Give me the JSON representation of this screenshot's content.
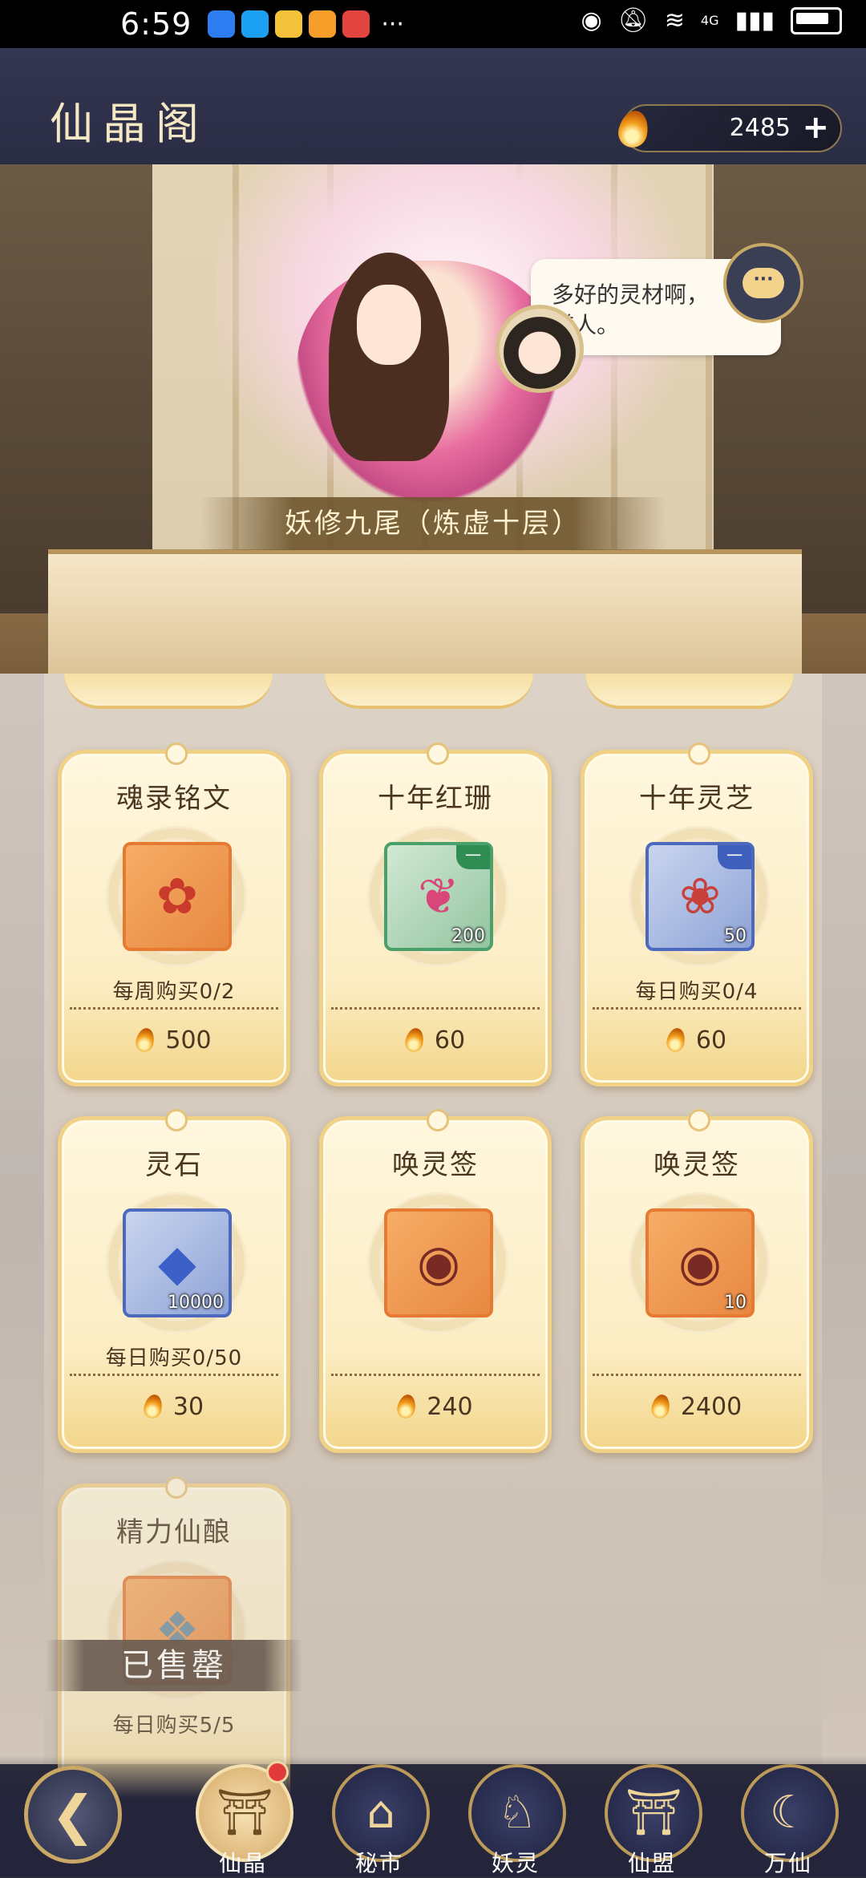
{
  "status_bar": {
    "time": "6:59",
    "apps": [
      "shield-app",
      "search-app",
      "weibo-app",
      "notes-app",
      "reader-app"
    ],
    "more": "···",
    "icons": [
      "eye-icon",
      "mute-icon",
      "wifi-icon",
      "signal-icon",
      "battery-icon"
    ],
    "network": "4G"
  },
  "header": {
    "title": "仙晶阁",
    "currency_amount": "2485",
    "plus": "+"
  },
  "banner": {
    "npc_label": "妖修九尾（炼虚十层）",
    "speech": "多好的灵材啊，\n道人。",
    "chat_button": "···"
  },
  "items": [
    {
      "name": "魂录铭文",
      "limit": "每周购买0/2",
      "price": "500",
      "qty": "",
      "corner": "",
      "style": "orange",
      "glyph": "✿",
      "glyph_color": "#c93a2a"
    },
    {
      "name": "十年红珊",
      "limit": "",
      "price": "60",
      "qty": "200",
      "corner": "一",
      "style": "green",
      "glyph": "❦",
      "glyph_color": "#d9467a"
    },
    {
      "name": "十年灵芝",
      "limit": "每日购买0/4",
      "price": "60",
      "qty": "50",
      "corner": "一",
      "style": "blue",
      "glyph": "❀",
      "glyph_color": "#c8403a"
    },
    {
      "name": "灵石",
      "limit": "每日购买0/50",
      "price": "30",
      "qty": "10000",
      "corner": "",
      "style": "blue",
      "glyph": "◆",
      "glyph_color": "#3c5fc8"
    },
    {
      "name": "唤灵签",
      "limit": "",
      "price": "240",
      "qty": "",
      "corner": "",
      "style": "orange",
      "glyph": "◉",
      "glyph_color": "#7a2a24"
    },
    {
      "name": "唤灵签",
      "limit": "",
      "price": "2400",
      "qty": "10",
      "corner": "",
      "style": "orange",
      "glyph": "◉",
      "glyph_color": "#7a2a24"
    },
    {
      "name": "精力仙酿",
      "limit": "每日购买5/5",
      "price": "",
      "qty": "",
      "corner": "",
      "style": "orange",
      "glyph": "❖",
      "glyph_color": "#6a8c9c",
      "sold_out": "已售罄"
    }
  ],
  "nav": [
    {
      "label": "仙晶",
      "icon": "pavilion-icon",
      "glyph": "⛩",
      "active": true,
      "badge": true
    },
    {
      "label": "秘市",
      "icon": "market-icon",
      "glyph": "⌂",
      "active": false,
      "badge": false
    },
    {
      "label": "妖灵",
      "icon": "fox-icon",
      "glyph": "♘",
      "active": false,
      "badge": false
    },
    {
      "label": "仙盟",
      "icon": "gate-icon",
      "glyph": "⛩",
      "active": false,
      "badge": false
    },
    {
      "label": "万仙",
      "icon": "moon-icon",
      "glyph": "☾",
      "active": false,
      "badge": false
    }
  ],
  "back_glyph": "❮",
  "colors": {
    "header_bg": "#2b2d45",
    "gold_border": "#c9a866",
    "card_bg": "#fbecc2",
    "text_brown": "#4a3520"
  }
}
